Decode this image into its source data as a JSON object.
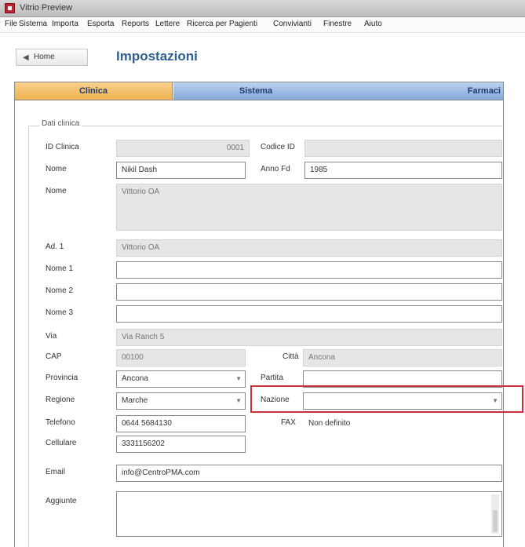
{
  "window": {
    "title": "Vitrio Preview"
  },
  "menu": [
    "File",
    "Sistema",
    "Importa",
    "Esporta",
    "Reports",
    "Lettere",
    "Ricerca per Pagienti",
    "Convivianti",
    "Finestre",
    "Aiuto"
  ],
  "toolbar": {
    "back_label": "Home",
    "back_icon": "back-icon",
    "page_title": "Impostazioni"
  },
  "tabs": {
    "clinica": "Clinica",
    "sistema": "Sistema",
    "farmaci": "Farmaci"
  },
  "form": {
    "group_title": "Dati clinica",
    "id_clinica": {
      "label": "ID Clinica",
      "value": "0001"
    },
    "codice_id": {
      "label": "Codice ID",
      "value": ""
    },
    "nome": {
      "label": "Nome",
      "value": "Nikil Dash"
    },
    "anno": {
      "label": "Anno Fd",
      "value": "1985"
    },
    "ragione": {
      "label": "Nome",
      "value": "Vittorio OA"
    },
    "adrl": {
      "label": "Ad. 1",
      "value": "Vittorio OA"
    },
    "nome1": {
      "label": "Nome 1",
      "value": ""
    },
    "nome2": {
      "label": "Nome 2",
      "value": ""
    },
    "nome3": {
      "label": "Nome 3",
      "value": ""
    },
    "via": {
      "label": "Via",
      "value": "Via Ranch 5"
    },
    "cap": {
      "label": "CAP",
      "value": "00100",
      "city_label": "Città",
      "city_value": "Ancona"
    },
    "provincia": {
      "label": "Provincia",
      "value": "Ancona"
    },
    "partita": {
      "label": "Partita",
      "value": ""
    },
    "regione": {
      "label": "Regione",
      "value": "Marche"
    },
    "nazione": {
      "label": "Nazione",
      "value": ""
    },
    "telefono": {
      "label": "Telefono",
      "value": "0644 5684130"
    },
    "fax": {
      "label": "FAX",
      "value": "Non definito"
    },
    "cellulare": {
      "label": "Cellulare",
      "value": "3331156202"
    },
    "email": {
      "label": "Email",
      "value": "info@CentroPMA.com"
    },
    "aggiunte": {
      "label": "Aggiunte",
      "value": ""
    }
  },
  "colors": {
    "accent": "#2e5f94",
    "tab_active": "#f0b250",
    "tab_inactive": "#84a9d9",
    "highlight": "#c8303a"
  }
}
